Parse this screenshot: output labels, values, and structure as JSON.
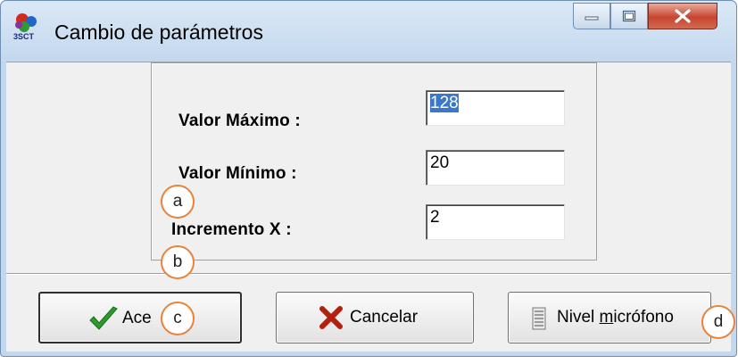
{
  "window": {
    "title": "Cambio de parámetros",
    "icon": "app-icon-3sct",
    "controls": {
      "minimize": "minimize-icon",
      "maximize": "maximize-icon",
      "close": "close-icon"
    }
  },
  "form": {
    "fields": [
      {
        "label": "Valor Máximo :",
        "value": "128",
        "selected": true
      },
      {
        "label": "Valor Mínimo :",
        "value": "20"
      },
      {
        "label": "Incremento X :",
        "value": "2"
      }
    ]
  },
  "buttons": {
    "accept": {
      "label": "Ace",
      "icon": "checkmark-icon",
      "color": "#2e9a2e"
    },
    "cancel": {
      "label": "Cancelar",
      "icon": "x-icon",
      "color": "#b32010"
    },
    "mic_level": {
      "label_pre": "Nivel ",
      "label_accel": "m",
      "label_post": "icrófono",
      "icon": "meter-icon"
    }
  },
  "annotations": [
    "a",
    "b",
    "c",
    "d"
  ]
}
